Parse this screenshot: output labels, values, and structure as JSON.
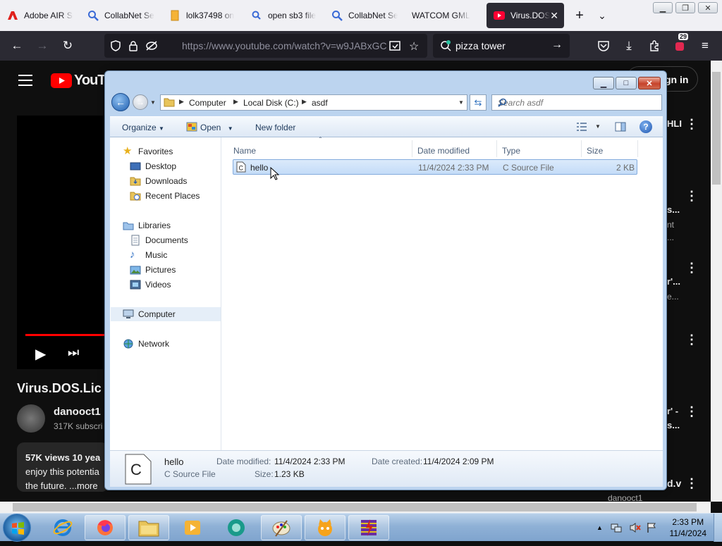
{
  "browser": {
    "tabs": [
      {
        "label": "Adobe AIR SD",
        "icon": "adobe-icon"
      },
      {
        "label": "CollabNet Se",
        "icon": "search-icon"
      },
      {
        "label": "lolk37498 on",
        "icon": "document-icon"
      },
      {
        "label": "open sb3 file",
        "icon": "search-icon"
      },
      {
        "label": "CollabNet Se",
        "icon": "search-icon"
      },
      {
        "label": "WATCOM GML",
        "icon": "globe-icon"
      },
      {
        "label": "Virus.DOS",
        "icon": "youtube-icon"
      }
    ],
    "url": "https://www.youtube.com/watch?v=w9JABxGC",
    "search_text": "pizza tower",
    "notification_badge": "29"
  },
  "youtube": {
    "logo": "YouTu",
    "sign_in": "gn in",
    "video_title": "Virus.DOS.Lic",
    "channel": "danooct1",
    "subscribers": "317K subscri",
    "views": "57K views  10 yea",
    "desc_line1": "enjoy this potentia",
    "desc_line2": "the future. ...more",
    "side_texts": [
      "HLI",
      "s...",
      "nt",
      "...",
      "r'...",
      "e...",
      "r' -",
      "s...",
      "d.v"
    ],
    "bottom_channel": "danooct1"
  },
  "explorer": {
    "breadcrumb": [
      "Computer",
      "Local Disk (C:)",
      "asdf"
    ],
    "search_placeholder": "Search asdf",
    "toolbar": {
      "organize": "Organize",
      "open": "Open",
      "new_folder": "New folder"
    },
    "nav": {
      "favorites": "Favorites",
      "desktop": "Desktop",
      "downloads": "Downloads",
      "recent": "Recent Places",
      "libraries": "Libraries",
      "documents": "Documents",
      "music": "Music",
      "pictures": "Pictures",
      "videos": "Videos",
      "computer": "Computer",
      "network": "Network"
    },
    "columns": {
      "name": "Name",
      "date": "Date modified",
      "type": "Type",
      "size": "Size"
    },
    "files": [
      {
        "name": "hello",
        "date": "11/4/2024 2:33 PM",
        "type": "C Source File",
        "size": "2 KB"
      }
    ],
    "details": {
      "name": "hello",
      "type": "C Source File",
      "modified_label": "Date modified:",
      "modified_value": "11/4/2024 2:33 PM",
      "size_label": "Size:",
      "size_value": "1.23 KB",
      "created_label": "Date created:",
      "created_value": "11/4/2024 2:09 PM"
    }
  },
  "taskbar": {
    "time": "2:33 PM",
    "date": "11/4/2024"
  }
}
